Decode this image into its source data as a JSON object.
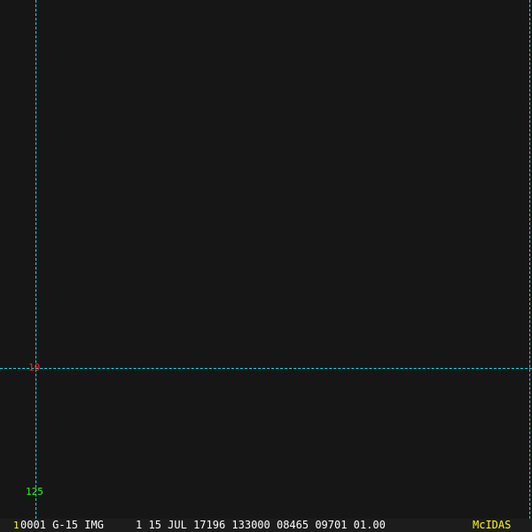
{
  "cursor": {
    "row_label": "10",
    "col_label": "125"
  },
  "status": {
    "frame_number": "1",
    "text": "0001 G-15 IMG     1 15 JUL 17196 133000 08465 09701 01.00",
    "brand": "McIDAS"
  },
  "colors": {
    "cursor": "#00e5ee",
    "row_label": "#ff2020",
    "col_label": "#20ff20",
    "brand": "#ffff00"
  }
}
